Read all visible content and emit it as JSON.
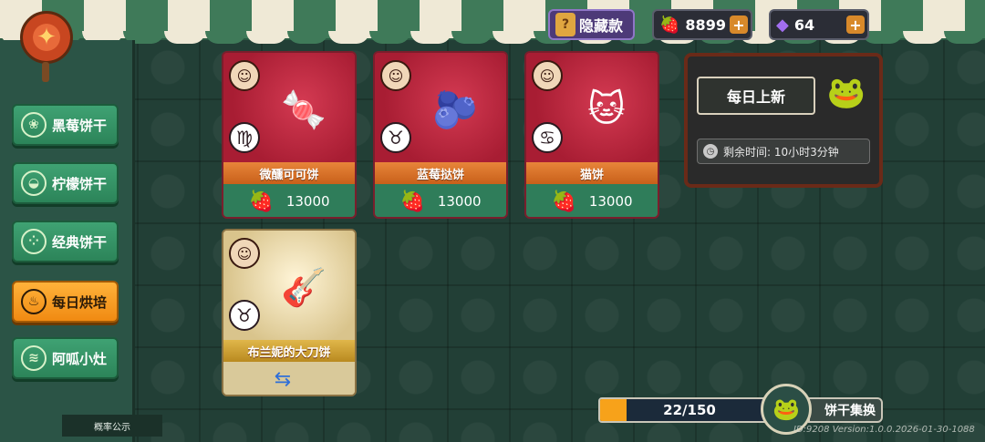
{
  "sidebar": {
    "items": [
      {
        "label": "黑莓饼干",
        "icon": "blackberry-icon",
        "glyph": "❀"
      },
      {
        "label": "柠檬饼干",
        "icon": "lemon-icon",
        "glyph": "◒"
      },
      {
        "label": "经典饼干",
        "icon": "cookie-icon",
        "glyph": "⁘"
      },
      {
        "label": "每日烘培",
        "icon": "bread-icon",
        "glyph": "♨",
        "active": true
      },
      {
        "label": "阿呱小灶",
        "icon": "stove-icon",
        "glyph": "≋"
      }
    ],
    "probability_label": "概率公示"
  },
  "topbar": {
    "hidden_label": "隐藏款",
    "strawberry_count": "8899",
    "gem_count": "64"
  },
  "cards": [
    {
      "name": "微醺可可饼",
      "price": "13000",
      "zodiac": "♍",
      "art": "🍬",
      "style": "red",
      "currency_icon": "strawberry-icon"
    },
    {
      "name": "蓝莓挞饼",
      "price": "13000",
      "zodiac": "♉",
      "art": "🫐",
      "style": "red",
      "currency_icon": "strawberry-icon"
    },
    {
      "name": "猫饼",
      "price": "13000",
      "zodiac": "♋",
      "art": "🐱",
      "style": "red",
      "currency_icon": "strawberry-icon"
    },
    {
      "name": "布兰妮的大刀饼",
      "price": "",
      "zodiac": "♉",
      "art": "🎸",
      "style": "gold",
      "currency_icon": "swap-icon"
    }
  ],
  "daily": {
    "title": "每日上新",
    "remaining": "剩余时间: 10小时3分钟"
  },
  "progress": {
    "text": "22/150",
    "fraction": 0.147
  },
  "exchange_label": "饼干集换",
  "version": "ID:9208 Version:1.0.0.2026-01-30-1088",
  "colors": {
    "active_tab": "#f08a12",
    "tab": "#2c8459",
    "card_red": "#a81d33",
    "progress_fill": "#f7a21a"
  }
}
